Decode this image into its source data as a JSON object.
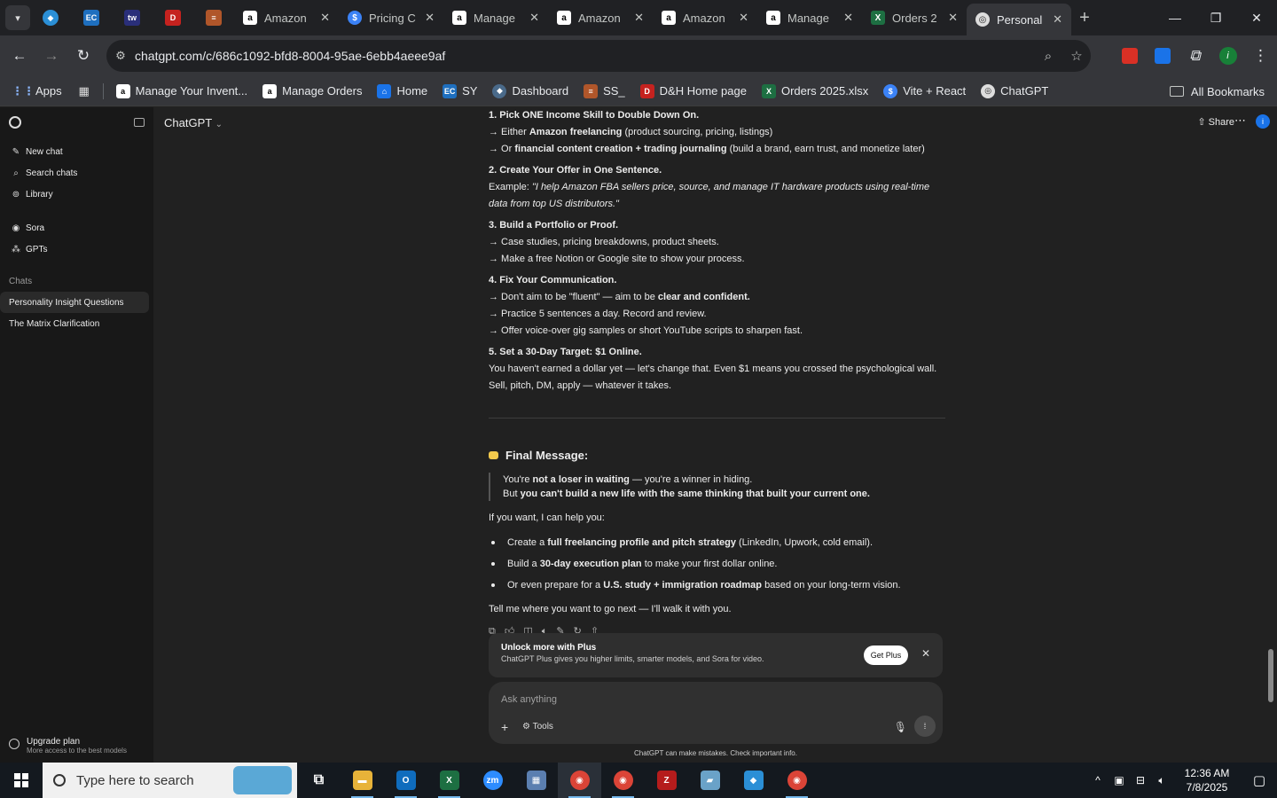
{
  "browser": {
    "tabs": [
      {
        "title": "Amazon",
        "icon": "amazon-icon"
      },
      {
        "title": "Pricing C",
        "icon": "pricing-icon"
      },
      {
        "title": "Manage",
        "icon": "amazon-icon"
      },
      {
        "title": "Amazon",
        "icon": "amazon-icon"
      },
      {
        "title": "Amazon",
        "icon": "amazon-icon"
      },
      {
        "title": "Manage",
        "icon": "amazon-icon"
      },
      {
        "title": "Orders 2",
        "icon": "excel-icon"
      },
      {
        "title": "Personal",
        "icon": "chatgpt-icon"
      }
    ],
    "url": "chatgpt.com/c/686c1092-bfd8-8004-95ae-6ebb4aeee9af",
    "bookmarks": [
      {
        "label": "Apps"
      },
      {
        "label": "Manage Your Invent..."
      },
      {
        "label": "Manage Orders"
      },
      {
        "label": "Home"
      },
      {
        "label": "SY"
      },
      {
        "label": "Dashboard"
      },
      {
        "label": "SS_"
      },
      {
        "label": "D&H Home page"
      },
      {
        "label": "Orders 2025.xlsx"
      },
      {
        "label": "Vite + React"
      },
      {
        "label": "ChatGPT"
      }
    ],
    "all_bookmarks": "All Bookmarks",
    "profile_initial": "i"
  },
  "sidebar": {
    "nav": [
      {
        "label": "New chat",
        "icon": "pencil-icon"
      },
      {
        "label": "Search chats",
        "icon": "search-icon"
      },
      {
        "label": "Library",
        "icon": "library-icon"
      }
    ],
    "nav2": [
      {
        "label": "Sora",
        "icon": "sora-icon"
      },
      {
        "label": "GPTs",
        "icon": "gpts-icon"
      }
    ],
    "chats_heading": "Chats",
    "chats": [
      "Personality Insight Questions",
      "The Matrix Clarification"
    ],
    "upgrade_title": "Upgrade plan",
    "upgrade_sub": "More access to the best models"
  },
  "header": {
    "model": "ChatGPT",
    "share": "Share",
    "account_initial": "i"
  },
  "message": {
    "s1_title": "1. Pick ONE Income Skill to Double Down On.",
    "s1_l1_pre": "→ Either ",
    "s1_l1_b": "Amazon freelancing",
    "s1_l1_post": " (product sourcing, pricing, listings)",
    "s1_l2_pre": "→ Or ",
    "s1_l2_b": "financial content creation + trading journaling",
    "s1_l2_post": " (build a brand, earn trust, and monetize later)",
    "s2_title": "2. Create Your Offer in One Sentence.",
    "s2_pre": "Example: ",
    "s2_quote": "\"I help Amazon FBA sellers price, source, and manage IT hardware products using real-time data from top US distributors.\"",
    "s3_title": "3. Build a Portfolio or Proof.",
    "s3_l1": "→ Case studies, pricing breakdowns, product sheets.",
    "s3_l2": "→ Make a free Notion or Google site to show your process.",
    "s4_title": "4. Fix Your Communication.",
    "s4_l1_pre": "→ Don't aim to be \"fluent\" — aim to be ",
    "s4_l1_b": "clear and confident.",
    "s4_l2": "→ Practice 5 sentences a day. Record and review.",
    "s4_l3": "→ Offer voice-over gig samples or short YouTube scripts to sharpen fast.",
    "s5_title": "5. Set a 30-Day Target: $1 Online.",
    "s5_body": "You haven't earned a dollar yet — let's change that. Even $1 means you crossed the psychological wall. Sell, pitch, DM, apply — whatever it takes.",
    "final_title": "Final Message:",
    "quote1_pre": "You're ",
    "quote1_b": "not a loser in waiting",
    "quote1_post": " — you're a winner in hiding.",
    "quote2_pre": "But ",
    "quote2_b": "you can't build a new life with the same thinking that built your current one.",
    "help_intro": "If you want, I can help you:",
    "bullets": [
      {
        "pre": "Create a ",
        "b": "full freelancing profile and pitch strategy",
        "post": " (LinkedIn, Upwork, cold email)."
      },
      {
        "pre": "Build a ",
        "b": "30-day execution plan",
        "post": " to make your first dollar online."
      },
      {
        "pre": "Or even prepare for a ",
        "b": "U.S. study + immigration roadmap",
        "post": " based on your long-term vision."
      }
    ],
    "closing": "Tell me where you want to go next — I'll walk it with you."
  },
  "plus_banner": {
    "title": "Unlock more with Plus",
    "subtitle": "ChatGPT Plus gives you higher limits, smarter models, and Sora for video.",
    "button": "Get Plus"
  },
  "composer": {
    "placeholder": "Ask anything",
    "tools": "Tools"
  },
  "disclaimer": "ChatGPT can make mistakes. Check important info.",
  "taskbar": {
    "search_placeholder": "Type here to search",
    "time": "12:36 AM",
    "date": "7/8/2025"
  },
  "colors": {
    "background": "#212121",
    "sidebar": "#181818",
    "chrome": "#35363a",
    "taskbar": "#14191f"
  }
}
